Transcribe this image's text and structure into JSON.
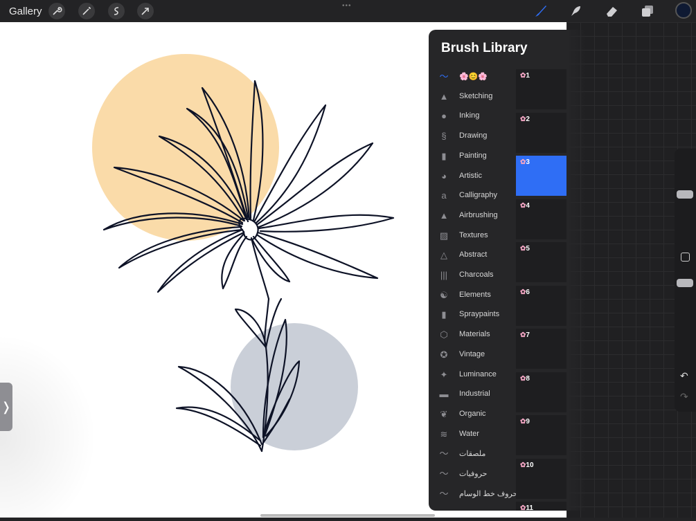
{
  "topbar": {
    "gallery_label": "Gallery",
    "tools_left": [
      "wrench-icon",
      "magic-wand-icon",
      "selection-icon",
      "transform-arrow-icon"
    ],
    "tools_right": [
      "brush-icon",
      "smudge-icon",
      "eraser-icon",
      "layers-icon",
      "color-icon"
    ],
    "active_tool": "brush-icon",
    "current_color": "#0f1a33",
    "accent": "#2f6ef5"
  },
  "brush_library": {
    "title": "Brush Library",
    "add_label": "+",
    "categories": [
      {
        "label": "🌸😊🌸",
        "icon": "brush-stroke-icon",
        "selected": true
      },
      {
        "label": "Sketching",
        "icon": "pencil-icon"
      },
      {
        "label": "Inking",
        "icon": "ink-drop-icon"
      },
      {
        "label": "Drawing",
        "icon": "squiggle-icon"
      },
      {
        "label": "Painting",
        "icon": "paint-brush-icon"
      },
      {
        "label": "Artistic",
        "icon": "palette-icon"
      },
      {
        "label": "Calligraphy",
        "icon": "calligraphy-icon"
      },
      {
        "label": "Airbrushing",
        "icon": "airbrush-icon"
      },
      {
        "label": "Textures",
        "icon": "texture-icon"
      },
      {
        "label": "Abstract",
        "icon": "triangle-icon"
      },
      {
        "label": "Charcoals",
        "icon": "charcoal-icon"
      },
      {
        "label": "Elements",
        "icon": "yin-yang-icon"
      },
      {
        "label": "Spraypaints",
        "icon": "spray-can-icon"
      },
      {
        "label": "Materials",
        "icon": "cube-icon"
      },
      {
        "label": "Vintage",
        "icon": "star-icon"
      },
      {
        "label": "Luminance",
        "icon": "sparkle-icon"
      },
      {
        "label": "Industrial",
        "icon": "anvil-icon"
      },
      {
        "label": "Organic",
        "icon": "leaf-icon"
      },
      {
        "label": "Water",
        "icon": "waves-icon"
      },
      {
        "label": "ملصقات",
        "icon": "brush-stroke-icon"
      },
      {
        "label": "حروفيات",
        "icon": "brush-stroke-icon"
      },
      {
        "label": "حروف خط الوسام",
        "icon": "brush-stroke-icon"
      }
    ],
    "brushes": [
      {
        "name": "1",
        "selected": false
      },
      {
        "name": "2",
        "selected": false
      },
      {
        "name": "3",
        "selected": true
      },
      {
        "name": "4",
        "selected": false
      },
      {
        "name": "5",
        "selected": false
      },
      {
        "name": "6",
        "selected": false
      },
      {
        "name": "7",
        "selected": false
      },
      {
        "name": "8",
        "selected": false
      },
      {
        "name": "9",
        "selected": false
      },
      {
        "name": "10",
        "selected": false
      },
      {
        "name": "11",
        "selected": false
      }
    ]
  },
  "sidebar": {
    "handle_label": "❭",
    "undo_icon": "undo-icon",
    "redo_icon": "redo-icon"
  },
  "artwork": {
    "sun_color": "#f9d59a",
    "moon_color": "#c4cad4",
    "ink_color": "#0d1226"
  }
}
